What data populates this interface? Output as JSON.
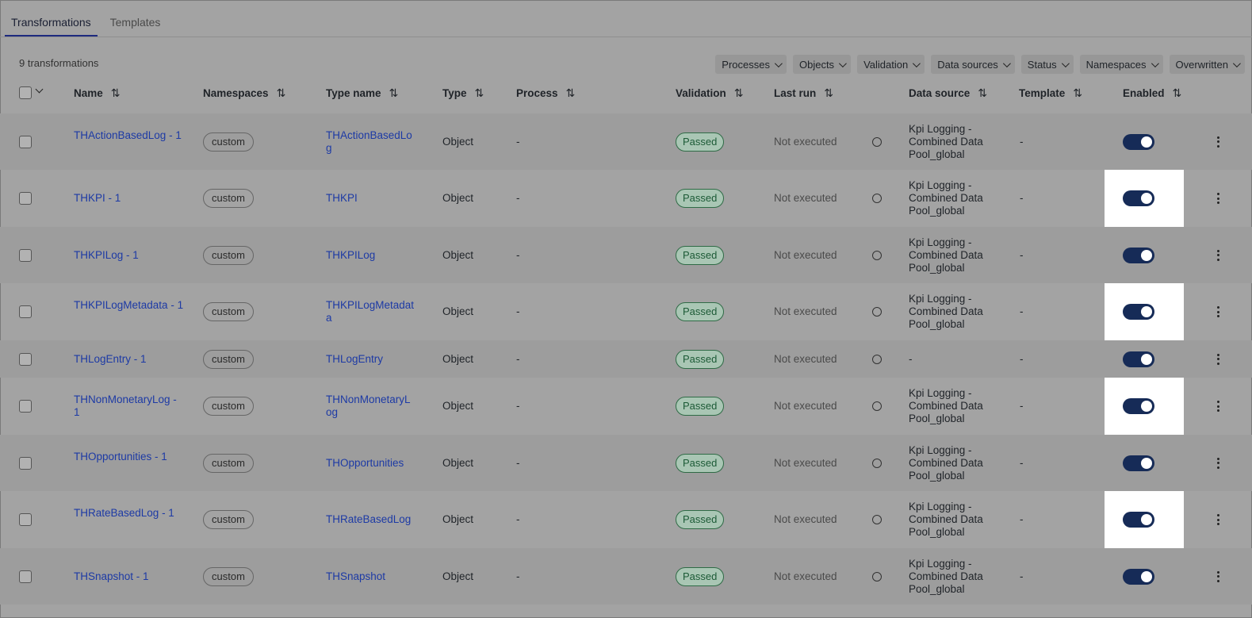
{
  "tabs": [
    {
      "label": "Transformations",
      "active": true
    },
    {
      "label": "Templates",
      "active": false
    }
  ],
  "count_label": "9 transformations",
  "filters": [
    "Processes",
    "Objects",
    "Validation",
    "Data sources",
    "Status",
    "Namespaces",
    "Overwritten"
  ],
  "columns": {
    "name": "Name",
    "namespaces": "Namespaces",
    "type_name": "Type name",
    "type": "Type",
    "process": "Process",
    "validation": "Validation",
    "last_run": "Last run",
    "data_source": "Data source",
    "template": "Template",
    "enabled": "Enabled"
  },
  "sort_icon": "⇅",
  "rows": [
    {
      "name": "THActionBasedLog - 1",
      "namespace": "custom",
      "type_name": "THActionBasedLog",
      "type": "Object",
      "process": "-",
      "validation": "Passed",
      "last_run": "Not executed",
      "data_source": "Kpi Logging - Combined Data Pool_global",
      "template": "-",
      "enabled": true
    },
    {
      "name": "THKPI - 1",
      "namespace": "custom",
      "type_name": "THKPI",
      "type": "Object",
      "process": "-",
      "validation": "Passed",
      "last_run": "Not executed",
      "data_source": "Kpi Logging - Combined Data Pool_global",
      "template": "-",
      "enabled": true
    },
    {
      "name": "THKPILog - 1",
      "namespace": "custom",
      "type_name": "THKPILog",
      "type": "Object",
      "process": "-",
      "validation": "Passed",
      "last_run": "Not executed",
      "data_source": "Kpi Logging - Combined Data Pool_global",
      "template": "-",
      "enabled": true
    },
    {
      "name": "THKPILogMetadata - 1",
      "namespace": "custom",
      "type_name": "THKPILogMetadata",
      "type": "Object",
      "process": "-",
      "validation": "Passed",
      "last_run": "Not executed",
      "data_source": "Kpi Logging - Combined Data Pool_global",
      "template": "-",
      "enabled": true
    },
    {
      "name": "THLogEntry - 1",
      "namespace": "custom",
      "type_name": "THLogEntry",
      "type": "Object",
      "process": "-",
      "validation": "Passed",
      "last_run": "Not executed",
      "data_source": "-",
      "template": "-",
      "enabled": true
    },
    {
      "name": "THNonMonetaryLog - 1",
      "namespace": "custom",
      "type_name": "THNonMonetaryLog",
      "type": "Object",
      "process": "-",
      "validation": "Passed",
      "last_run": "Not executed",
      "data_source": "Kpi Logging - Combined Data Pool_global",
      "template": "-",
      "enabled": true
    },
    {
      "name": "THOpportunities - 1",
      "namespace": "custom",
      "type_name": "THOpportunities",
      "type": "Object",
      "process": "-",
      "validation": "Passed",
      "last_run": "Not executed",
      "data_source": "Kpi Logging - Combined Data Pool_global",
      "template": "-",
      "enabled": true
    },
    {
      "name": "THRateBasedLog - 1",
      "namespace": "custom",
      "type_name": "THRateBasedLog",
      "type": "Object",
      "process": "-",
      "validation": "Passed",
      "last_run": "Not executed",
      "data_source": "Kpi Logging - Combined Data Pool_global",
      "template": "-",
      "enabled": true
    },
    {
      "name": "THSnapshot - 1",
      "namespace": "custom",
      "type_name": "THSnapshot",
      "type": "Object",
      "process": "-",
      "validation": "Passed",
      "last_run": "Not executed",
      "data_source": "Kpi Logging - Combined Data Pool_global",
      "template": "-",
      "enabled": true
    }
  ]
}
